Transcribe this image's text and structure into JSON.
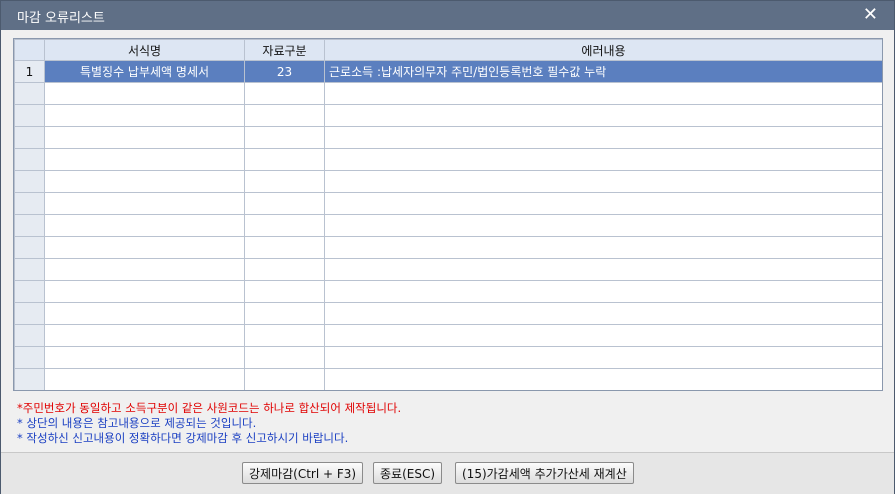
{
  "window": {
    "title": "마감 오류리스트"
  },
  "grid": {
    "columns": [
      "",
      "서식명",
      "자료구분",
      "에러내용"
    ],
    "rows": [
      {
        "no": "1",
        "form": "특별징수 납부세액 명세서",
        "code": "23",
        "message": "근로소득 :납세자의무자 주민/법인등록번호 필수값 누락"
      }
    ]
  },
  "notes": {
    "line1": "*주민번호가 동일하고 소득구분이 같은 사원코드는 하나로 합산되어 제작됩니다.",
    "line2": "* 상단의 내용은 참고내용으로 제공되는 것입니다.",
    "line3": "* 작성하신 신고내용이 정확하다면 강제마감 후 신고하시기 바랍니다."
  },
  "buttons": {
    "force_close": "강제마감(Ctrl + F3)",
    "exit": "종료(ESC)",
    "recalc": "(15)가감세액 추가가산세 재계산"
  },
  "colors": {
    "titlebar": "#5f6f86",
    "selected_row": "#5b7fbf",
    "note_red": "#e00000",
    "note_blue": "#1a3fc2"
  }
}
